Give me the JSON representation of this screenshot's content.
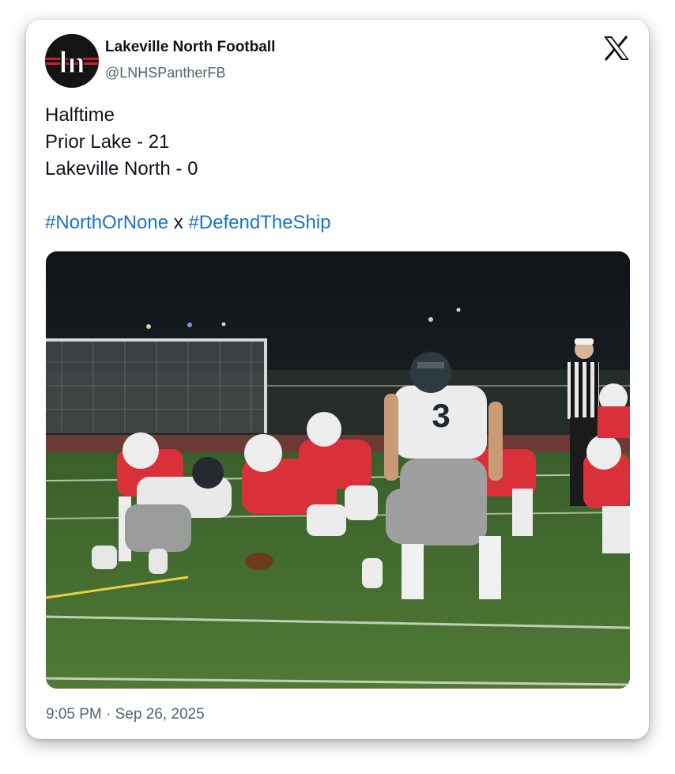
{
  "author": {
    "display_name": "Lakeville North Football",
    "handle": "@LNHSPantherFB",
    "avatar_text": "ln"
  },
  "tweet": {
    "lines": [
      "Halftime",
      "Prior Lake - 21",
      "Lakeville North - 0"
    ],
    "hashtags": [
      "#NorthOrNone",
      "#DefendTheShip"
    ],
    "hashtag_separator": "x",
    "timestamp": "9:05 PM · Sep 26, 2025"
  },
  "media": {
    "jersey_number": "3"
  },
  "icons": {
    "platform_logo": "x-logo-icon"
  },
  "colors": {
    "hashtag": "#1d72c4",
    "text": "#0f1419",
    "secondary": "#536471",
    "home_red": "#d9303a",
    "away_white": "#e9e9e9",
    "field_green": "#3f6a2e"
  }
}
